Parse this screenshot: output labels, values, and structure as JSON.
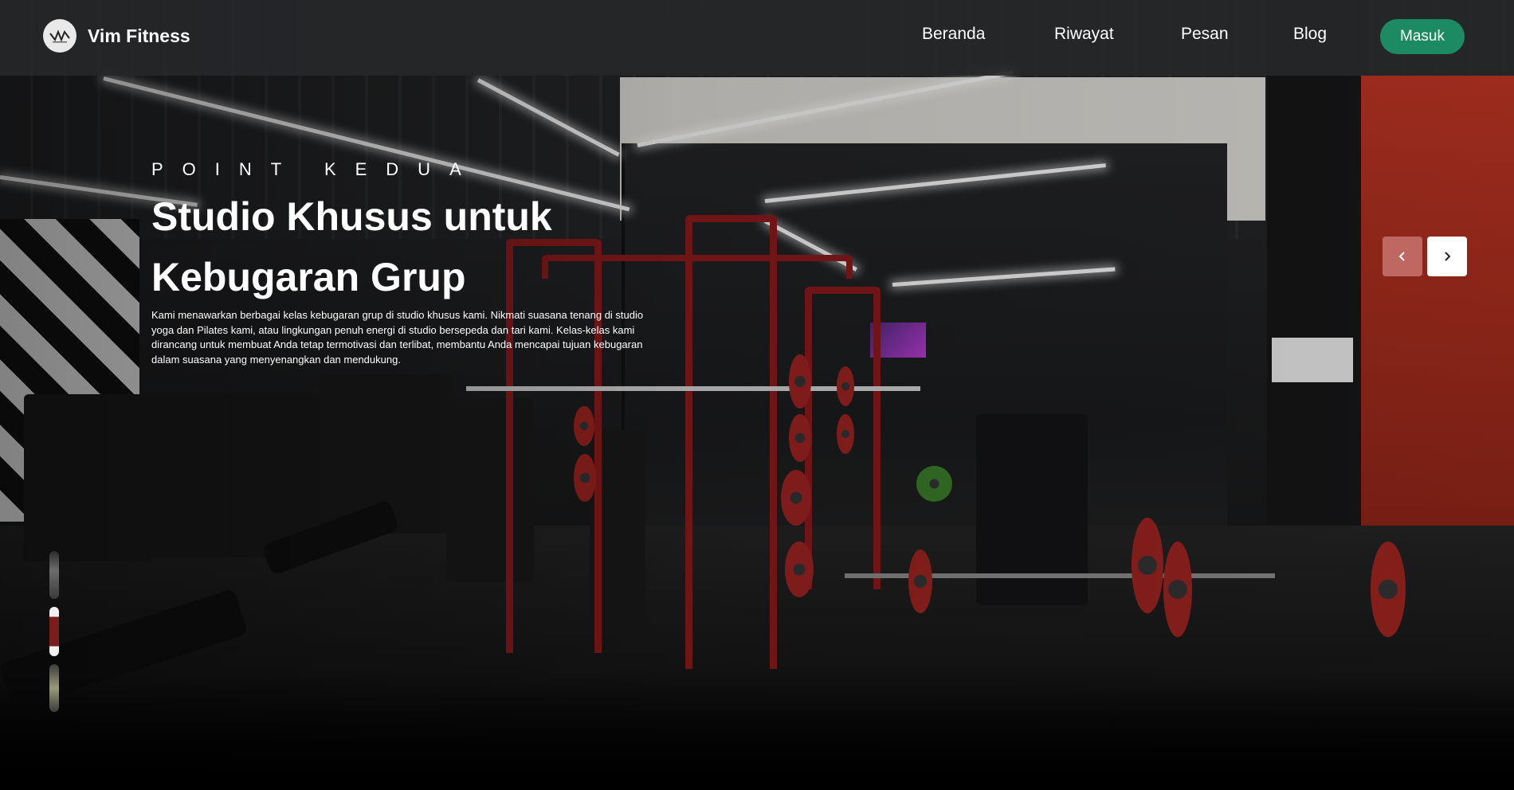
{
  "header": {
    "brand_name": "Vim Fitness",
    "logo_icon": "vim-fitness-logo",
    "nav": [
      {
        "label": "Beranda"
      },
      {
        "label": "Riwayat"
      },
      {
        "label": "Pesan"
      },
      {
        "label": "Blog"
      }
    ],
    "login_label": "Masuk",
    "login_color": "#1c8a62"
  },
  "hero": {
    "eyebrow": "POINT KEDUA",
    "title": "Studio Khusus untuk Kebugaran Grup",
    "description": "Kami menawarkan berbagai kelas kebugaran grup di studio khusus kami. Nikmati suasana tenang di studio yoga dan Pilates kami, atau lingkungan penuh energi di studio bersepeda dan tari kami. Kelas-kelas kami dirancang untuk membuat Anda tetap termotivasi dan terlibat, membantu Anda mencapai tujuan kebugaran dalam suasana yang menyenangkan dan mendukung."
  },
  "carousel": {
    "prev_icon": "chevron-left-icon",
    "next_icon": "chevron-right-icon",
    "thumbnail_count": 3
  }
}
